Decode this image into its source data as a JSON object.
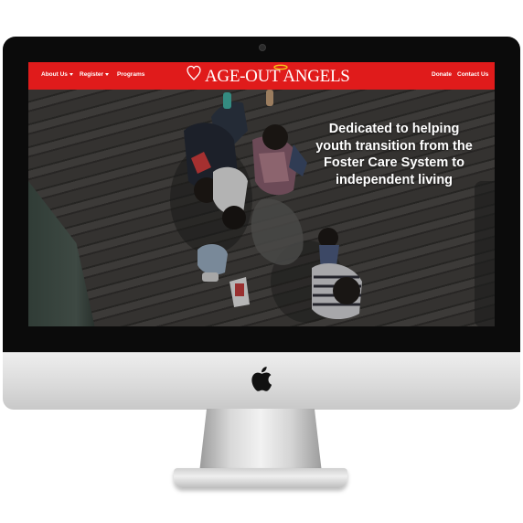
{
  "nav": {
    "about_label": "About Us",
    "register_label": "Register",
    "programs_label": "Programs",
    "donate_label": "Donate",
    "contact_label": "Contact Us"
  },
  "logo": {
    "text": "AGE-OUT ANGELS",
    "icon": "heart-outline-icon",
    "halo_icon": "halo-icon"
  },
  "hero": {
    "line1": "Dedicated to helping",
    "line2": "youth transition from the",
    "line3": "Foster Care System to",
    "line4": "independent living"
  },
  "colors": {
    "nav_bg": "#e01b1b",
    "nav_text": "#ffffff",
    "halo": "#f5c518"
  },
  "device": {
    "logo_icon": "apple-logo-icon"
  }
}
